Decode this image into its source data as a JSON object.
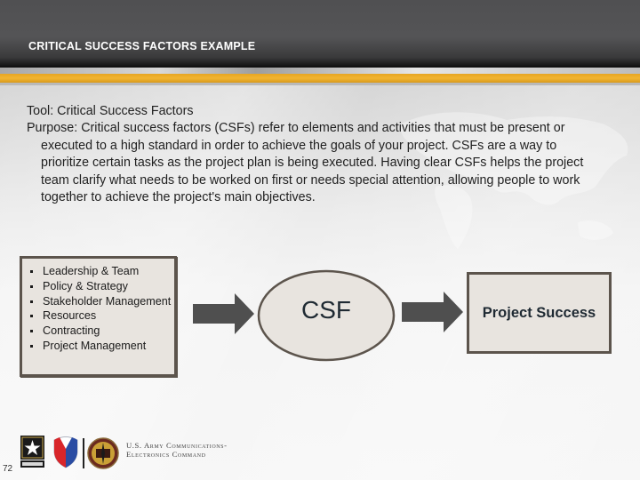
{
  "header": {
    "title": "CRITICAL SUCCESS FACTORS EXAMPLE"
  },
  "colors": {
    "header_dark": "#545456",
    "gold_band": "#f2b531",
    "box_fill": "#e8e4df",
    "box_border": "#5c544c",
    "arrow_fill": "#4f4f4f",
    "text_dark": "#1f2a33"
  },
  "body": {
    "tool_line": "Tool: Critical Success Factors",
    "purpose_line": "Purpose: Critical success factors (CSFs) refer to elements and activities that must be present or executed to a high standard in order to achieve the goals of your project. CSFs are a way to prioritize certain tasks as the project plan is being executed. Having clear CSFs helps the project team clarify what needs to be worked on first or needs special attention, allowing people to work together to achieve the project's main objectives."
  },
  "diagram": {
    "factors": [
      "Leadership & Team",
      "Policy & Strategy",
      "Stakeholder Management",
      "Resources",
      "Contracting",
      "Project Management"
    ],
    "center_label": "CSF",
    "outcome_label": "Project Success"
  },
  "footer": {
    "page_number": "72",
    "org_line1": "U.S. Army Communications-",
    "org_line2": "Electronics Command",
    "logos": [
      "us-army-star-logo",
      "army-materiel-command-shield-logo",
      "cecom-emblem-logo"
    ]
  }
}
